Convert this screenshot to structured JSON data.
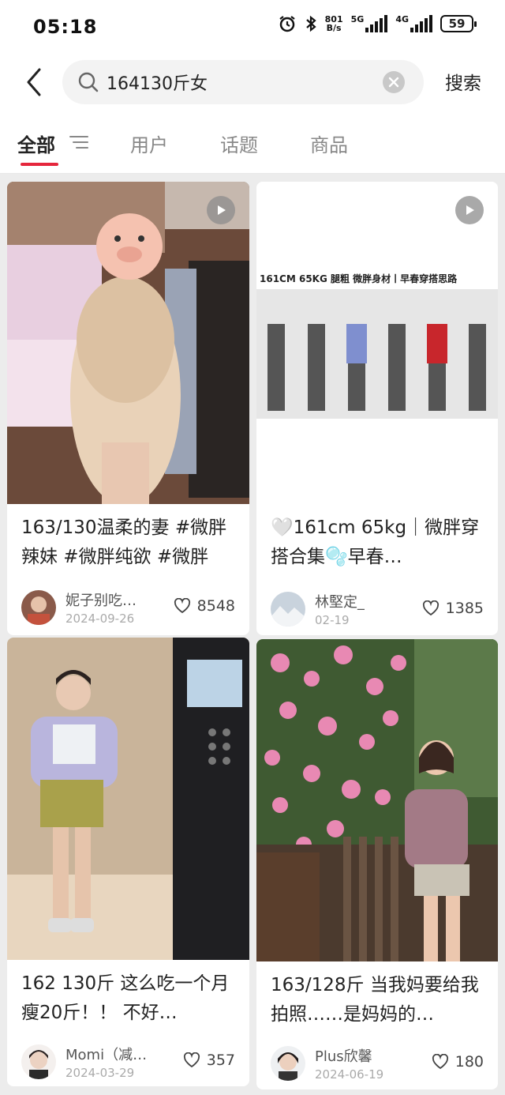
{
  "status": {
    "time": "05:18",
    "net_speed_top": "801",
    "net_speed_bottom": "B/s",
    "sig1": "5G",
    "sig2": "4G",
    "battery": "59"
  },
  "search": {
    "query": "164130斤女",
    "button_label": "搜索"
  },
  "tabs": [
    {
      "label": "全部",
      "active": true
    },
    {
      "label": "用户",
      "active": false
    },
    {
      "label": "话题",
      "active": false
    },
    {
      "label": "商品",
      "active": false
    }
  ],
  "posts": [
    {
      "title": "163/130温柔的妻 #微胖辣妹 #微胖纯欲 #微胖",
      "author": "妮子别吃…",
      "date": "2024-09-26",
      "likes": "8548",
      "video": true
    },
    {
      "title": "🤍161cm 65kg｜微胖穿搭合集🫧早春…",
      "author": "林堅定_",
      "date": "02-19",
      "likes": "1385",
      "video": true,
      "banner": "161CM 65KG 腿粗 微胖身材丨早春穿搭思路"
    },
    {
      "title": "162 130斤 这么吃一个月瘦20斤！！ 不好…",
      "author": "Momi（减…",
      "date": "2024-03-29",
      "likes": "357",
      "video": false
    },
    {
      "title": "163/128斤 当我妈要给我拍照……是妈妈的…",
      "author": "Plus欣馨",
      "date": "2024-06-19",
      "likes": "180",
      "video": false
    }
  ],
  "colors": {
    "accent": "#e5263c",
    "background": "#ececec"
  },
  "icons": [
    "back-arrow-icon",
    "search-icon",
    "clear-icon",
    "filter-icon",
    "play-icon",
    "heart-icon",
    "alarm-icon",
    "bluetooth-icon"
  ]
}
